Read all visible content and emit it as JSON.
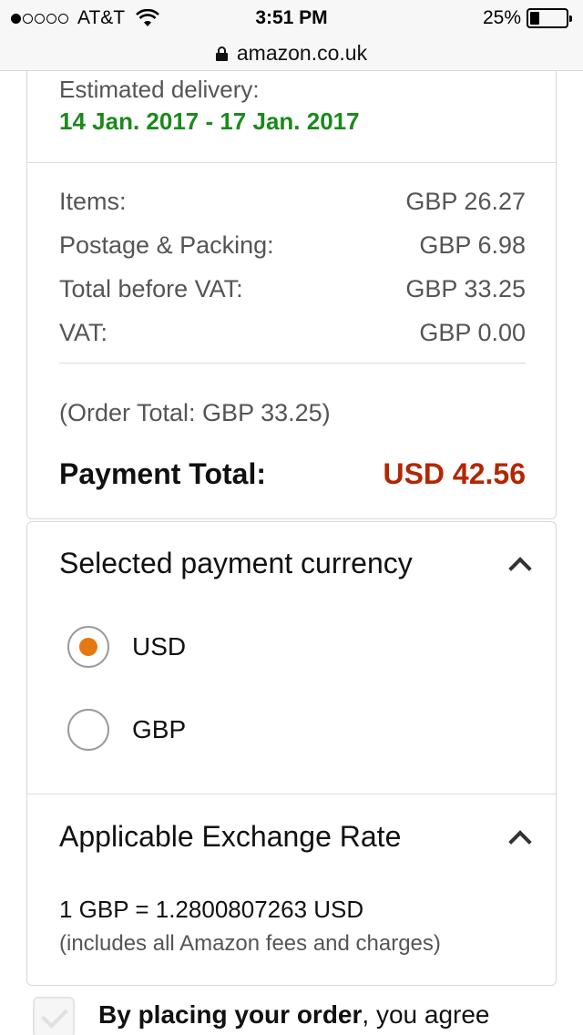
{
  "status_bar": {
    "carrier": "AT&T",
    "time": "3:51 PM",
    "battery": "25%",
    "battery_level": 0.25,
    "signal_bars_filled": 1,
    "signal_bars_total": 5
  },
  "url_bar": {
    "url": "amazon.co.uk",
    "icon": "lock-icon"
  },
  "delivery": {
    "label": "Estimated delivery:",
    "dates": "14 Jan. 2017 - 17 Jan. 2017"
  },
  "summary": {
    "rows": [
      {
        "label": "Items:",
        "value": "GBP 26.27"
      },
      {
        "label": "Postage & Packing:",
        "value": "GBP 6.98"
      },
      {
        "label": "Total before VAT:",
        "value": "GBP 33.25"
      },
      {
        "label": "VAT:",
        "value": "GBP 0.00"
      }
    ],
    "order_total": "(Order Total: GBP 33.25)",
    "payment_total_label": "Payment Total:",
    "payment_total_value": "USD 42.56"
  },
  "currency": {
    "heading": "Selected payment currency",
    "options": [
      {
        "label": "USD",
        "selected": true
      },
      {
        "label": "GBP",
        "selected": false
      }
    ]
  },
  "exchange": {
    "heading": "Applicable Exchange Rate",
    "rate": "1 GBP = 1.2800807263 USD",
    "note": "(includes all Amazon fees and charges)"
  },
  "agreement": {
    "bold": "By placing your order",
    "rest": ", you agree"
  },
  "colors": {
    "delivery_green": "#1a8a1a",
    "payment_red": "#b12704",
    "radio_orange": "#e47911"
  }
}
